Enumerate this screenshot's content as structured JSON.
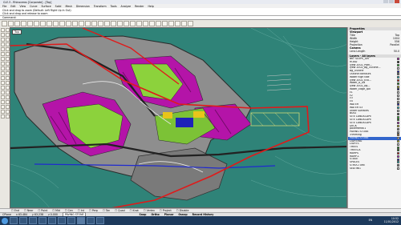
{
  "window": {
    "title": "CLE.3 - Rhinoceros [Corporate] - [Top]"
  },
  "menu": [
    "File",
    "Edit",
    "View",
    "Curve",
    "Surface",
    "Solid",
    "Mesh",
    "Dimension",
    "Transform",
    "Tools",
    "Analyze",
    "Render",
    "Help"
  ],
  "command": {
    "history_1": "Click and drag to zoom (Default: Left Right Up In Out)",
    "history_2": "Click and drag and release to zoom",
    "prompt": "Command:"
  },
  "viewport": {
    "label": "Top"
  },
  "properties": {
    "title": "Properties",
    "viewport_section": "Viewport",
    "rows": [
      {
        "k": "Title",
        "v": "Top"
      },
      {
        "k": "Width",
        "v": "1004"
      },
      {
        "k": "Height",
        "v": "556"
      },
      {
        "k": "Projection",
        "v": "Parallel"
      }
    ],
    "camera_section": "Camera",
    "lens": {
      "k": "Lens Length",
      "v": "50.0"
    }
  },
  "layers": {
    "title": "Layers - All layers",
    "items": [
      {
        "name": "BKT SLOPE_GM",
        "color": "#ff00ff"
      },
      {
        "name": "ROAD",
        "color": "#000000"
      },
      {
        "name": "Iyew 2002_Path...",
        "color": "#00ff00"
      },
      {
        "name": "Iyew 2002_Bg_Outline...",
        "color": "#ffffff"
      },
      {
        "name": "Bg_Outline",
        "color": "#0000ff"
      },
      {
        "name": "Outline contours",
        "color": "#888888"
      },
      {
        "name": "Water high tide",
        "color": "#00ffff"
      },
      {
        "name": "Iyew 2002_Eco...",
        "color": "#ff0000"
      },
      {
        "name": "Water_A_Gd",
        "color": "#00aa00"
      },
      {
        "name": "Iyew 2002_Aq...",
        "color": "#ffff00"
      },
      {
        "name": "Water_Edge_Ipd",
        "color": "#000088"
      },
      {
        "name": "c1",
        "color": "#ffffff"
      },
      {
        "name": "c2",
        "color": "#ffffff"
      },
      {
        "name": "c3",
        "color": "#ffffff"
      },
      {
        "name": "c4",
        "color": "#ffffff"
      },
      {
        "name": "WATER",
        "color": "#0000ff"
      },
      {
        "name": "WATER 03",
        "color": "#00ffff"
      },
      {
        "name": "under surfaces",
        "color": "#ffffff"
      },
      {
        "name": "BUILT",
        "color": "#444444"
      },
      {
        "name": "SITE LANDSCAPE",
        "color": "#00ff00"
      },
      {
        "name": "SITE LANDSCAPE",
        "color": "#008800"
      },
      {
        "name": "SITE LANDSCAPE",
        "color": "#ff00ff"
      },
      {
        "name": "DECK",
        "color": "#ffff00"
      },
      {
        "name": "pavement01",
        "color": "#888888"
      },
      {
        "name": "PAVING STONE",
        "color": "#aaaaaa"
      },
      {
        "name": "Trimming",
        "color": "#ff8800"
      },
      {
        "name": "PAVING STONE",
        "color": "#ffffff",
        "current": true
      },
      {
        "name": "LIGHTING",
        "color": "#ffff00"
      },
      {
        "name": "LIGHTS",
        "color": "#ffffff"
      },
      {
        "name": "TREES",
        "color": "#00aa00"
      },
      {
        "name": "TREES-A",
        "color": "#008800"
      },
      {
        "name": "RAMPS",
        "color": "#ff0000"
      },
      {
        "name": "RAMP-L",
        "color": "#ff00ff"
      },
      {
        "name": "STAGE",
        "color": "#0000ff"
      },
      {
        "name": "SPACES",
        "color": "#00ffff"
      },
      {
        "name": "STRUCTURE",
        "color": "#888888"
      },
      {
        "name": "SEATING",
        "color": "#ffffff"
      }
    ]
  },
  "osnap": [
    "End",
    "Near",
    "Point",
    "Mid",
    "Cen",
    "Int",
    "Perp",
    "Tan",
    "Quad",
    "Knot",
    "Vertex",
    "Project",
    "Disable"
  ],
  "status": {
    "cplane": "CPlane",
    "x": "x 63.484",
    "y": "y 63.238",
    "z": "z 0.000",
    "layer": "PAVING STONE",
    "toggles": [
      "Snap",
      "Ortho",
      "Planar",
      "Osnap",
      "Record History"
    ]
  },
  "taskbar": {
    "language": "EN",
    "time": "10:52",
    "date": "11/01/2012"
  },
  "colors": {
    "ocean": "#2f8378",
    "magenta": "#b414a8",
    "green": "#8cd23c",
    "red_line": "#e01a1a"
  }
}
